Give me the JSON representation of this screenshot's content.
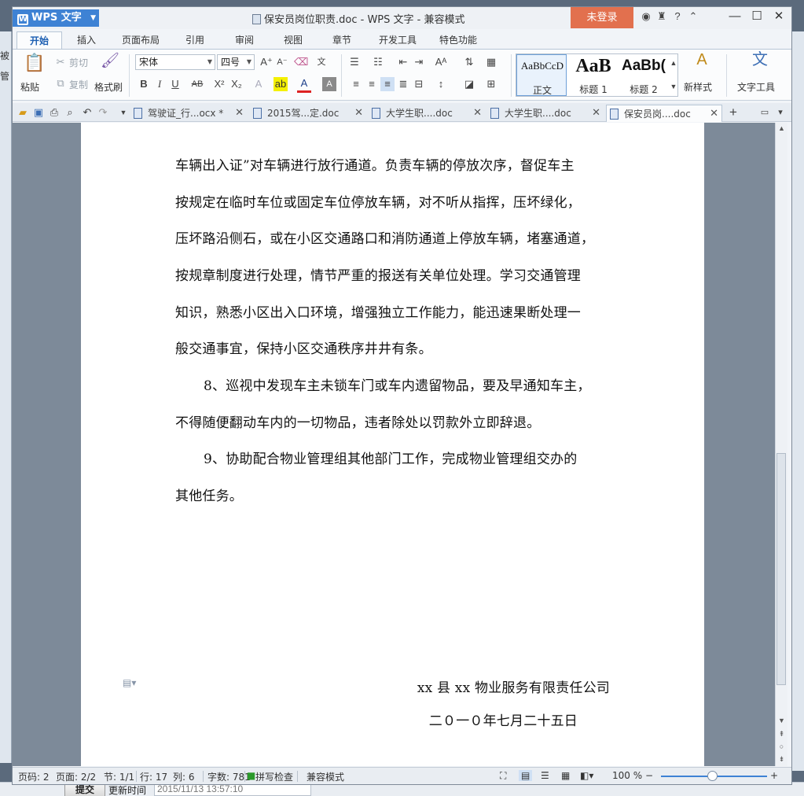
{
  "background": {
    "left_fragments": [
      "被",
      "管"
    ],
    "bottom": {
      "submit_label": "提交",
      "update_label": "更新时间",
      "update_value": "2015/11/13 13:57:10"
    }
  },
  "titlebar": {
    "app_name": "WPS 文字",
    "doc_title": "保安员岗位职责.doc - WPS 文字 - 兼容模式",
    "login_label": "未登录"
  },
  "ribbon_tabs": [
    "开始",
    "插入",
    "页面布局",
    "引用",
    "审阅",
    "视图",
    "章节",
    "开发工具",
    "特色功能"
  ],
  "ribbon": {
    "paste": "粘贴",
    "cut": "剪切",
    "copy": "复制",
    "format_painter": "格式刷",
    "font_name": "宋体",
    "font_size": "四号",
    "styles": [
      {
        "sample": "AaBbCcD",
        "label": "正文"
      },
      {
        "sample": "AaB",
        "label": "标题 1"
      },
      {
        "sample": "AaBb(",
        "label": "标题 2"
      }
    ],
    "new_style": "新样式",
    "text_tools": "文字工具"
  },
  "doc_tabs": [
    "驾驶证_行...ocx *",
    "2015驾...定.doc",
    "大学生职....doc",
    "大学生职....doc",
    "保安员岗....doc"
  ],
  "document": {
    "lines": [
      "车辆出入证”对车辆进行放行通道。负责车辆的停放次序，督促车主",
      "按规定在临时车位或固定车位停放车辆，对不听从指挥，压坏绿化，",
      "压坏路沿侧石，或在小区交通路口和消防通道上停放车辆，堵塞通道，",
      "按规章制度进行处理，情节严重的报送有关单位处理。学习交通管理",
      "知识，熟悉小区出入口环境，增强独立工作能力，能迅速果断处理一",
      "般交通事宜，保持小区交通秩序井井有条。",
      "8、巡视中发现车主未锁车门或车内遗留物品，要及早通知车主，",
      "不得随便翻动车内的一切物品，违者除处以罚款外立即辞退。",
      "9、协助配合物业管理组其他部门工作，完成物业管理组交办的",
      "其他任务。"
    ],
    "company": "xx 县 xx 物业服务有限责任公司",
    "date": "二０一０年七月二十五日"
  },
  "status": {
    "page_no": "页码: 2",
    "pages": "页面: 2/2",
    "section": "节: 1/1",
    "row": "行: 17",
    "col": "列: 6",
    "words": "字数: 781",
    "spell": "拼写检查",
    "compat": "兼容模式",
    "zoom": "100 %"
  }
}
